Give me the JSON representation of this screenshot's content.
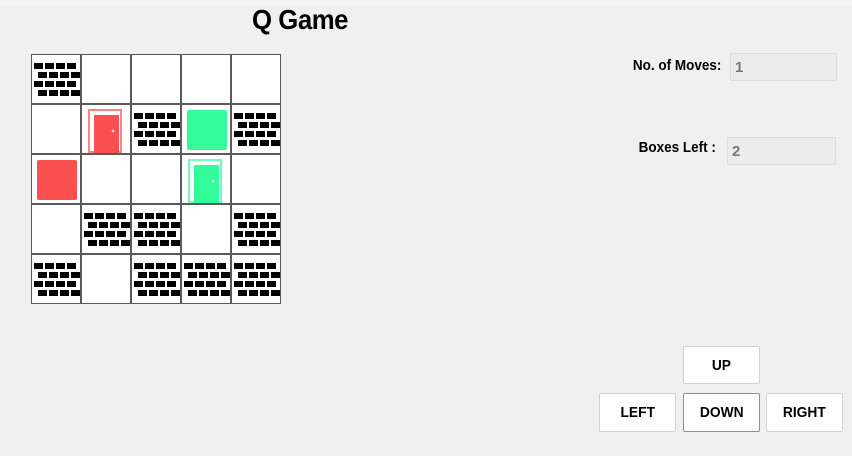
{
  "title": "Q Game",
  "board": {
    "rows": 5,
    "cols": 5,
    "cells": [
      [
        "wall",
        "empty",
        "empty",
        "empty",
        "empty"
      ],
      [
        "empty",
        "red-door",
        "wall",
        "green-box",
        "wall"
      ],
      [
        "red-box",
        "empty",
        "empty",
        "green-door",
        "empty"
      ],
      [
        "empty",
        "wall",
        "wall",
        "empty",
        "wall"
      ],
      [
        "wall",
        "empty",
        "wall",
        "wall",
        "wall"
      ]
    ]
  },
  "colors": {
    "red": "#fb5050",
    "green": "#33fb99",
    "wall": "#000000",
    "cell": "#ffffff",
    "background": "#f0f0f0"
  },
  "moves": {
    "label": "No. of Moves:",
    "value": "1"
  },
  "boxes": {
    "label": "Boxes Left :",
    "value": "2"
  },
  "controls": {
    "up": "UP",
    "left": "LEFT",
    "down": "DOWN",
    "right": "RIGHT",
    "focused": "down"
  }
}
